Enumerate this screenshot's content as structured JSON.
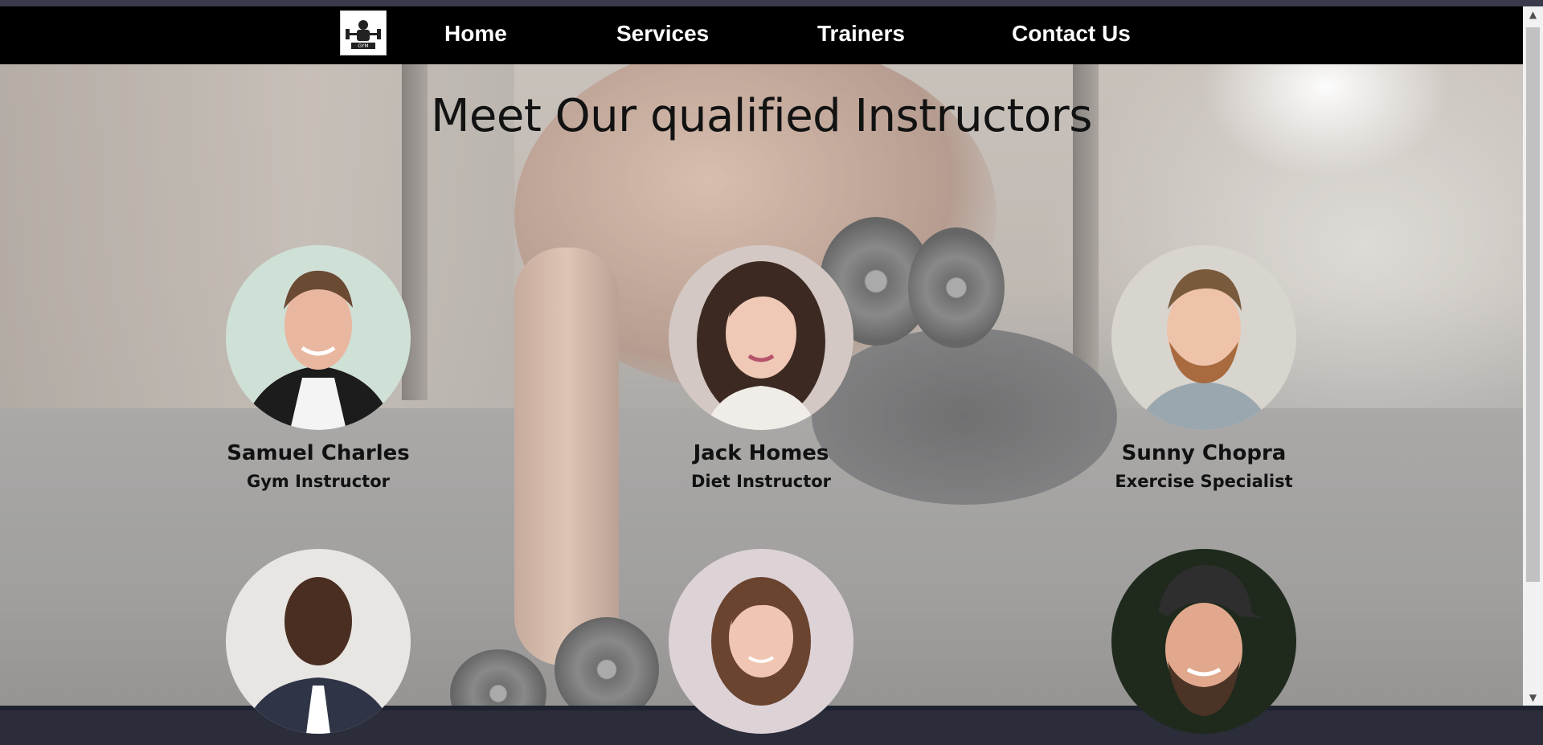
{
  "nav": {
    "logo_label": "GYM",
    "links": [
      {
        "label": "Home"
      },
      {
        "label": "Services"
      },
      {
        "label": "Trainers"
      },
      {
        "label": "Contact Us"
      }
    ]
  },
  "page": {
    "title": "Meet Our qualified Instructors"
  },
  "trainers": [
    {
      "name": "Samuel Charles",
      "role": "Gym Instructor"
    },
    {
      "name": "Jack Homes",
      "role": "Diet Instructor"
    },
    {
      "name": "Sunny Chopra",
      "role": "Exercise Specialist"
    },
    {
      "name": "",
      "role": ""
    },
    {
      "name": "",
      "role": ""
    },
    {
      "name": "",
      "role": ""
    }
  ],
  "colors": {
    "navbar": "#000000",
    "nav_text": "#ffffff",
    "title_text": "#121212"
  },
  "icons": {
    "logo": "gym-logo-icon",
    "scroll_up": "arrow-up-icon",
    "scroll_down": "arrow-down-icon"
  }
}
